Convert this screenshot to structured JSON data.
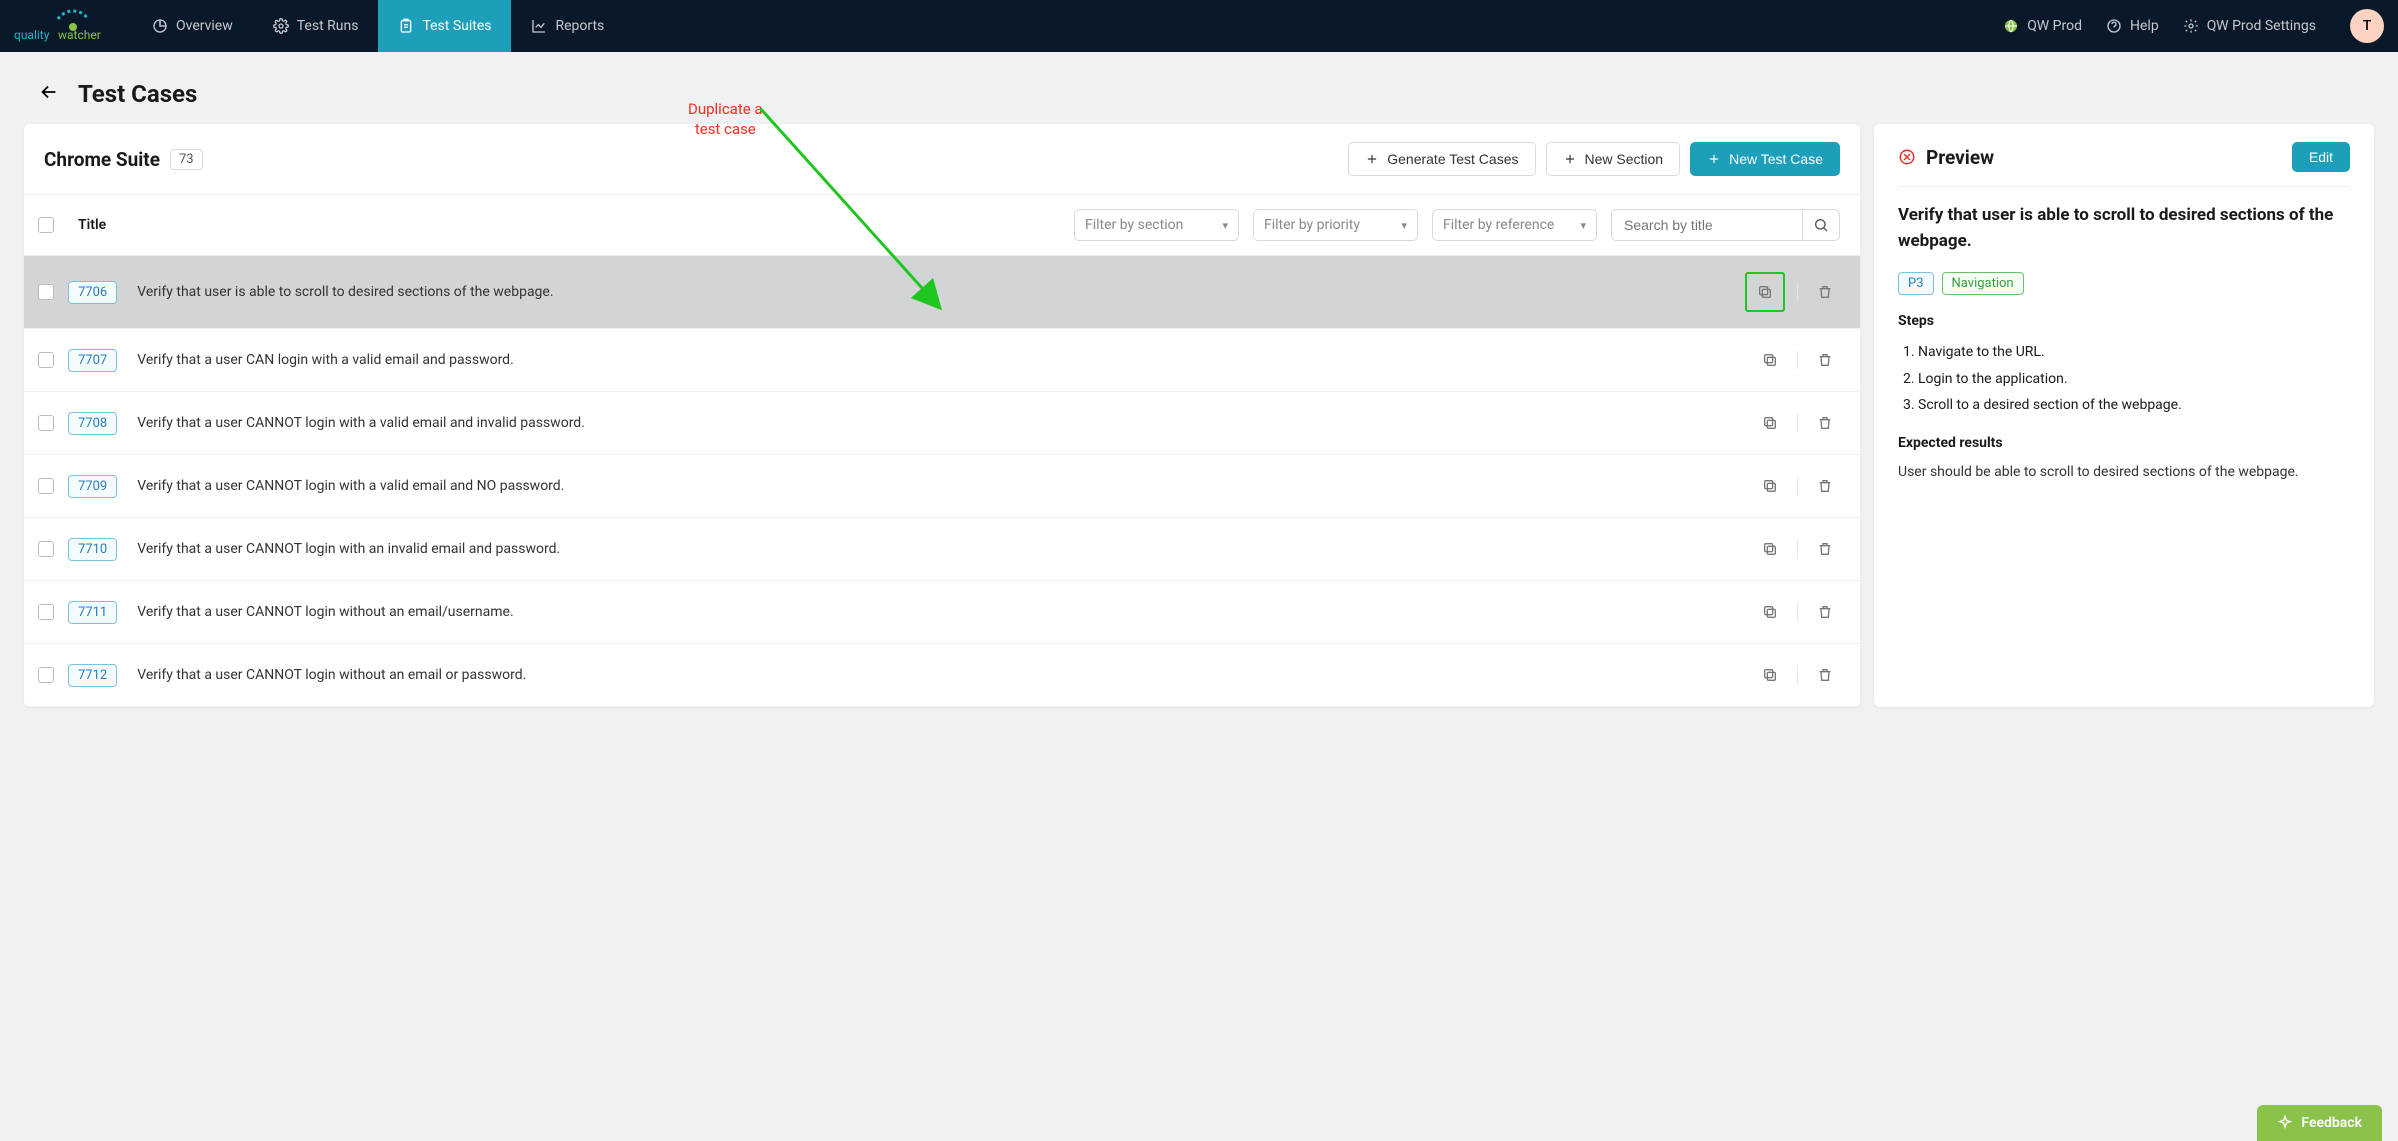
{
  "brand": {
    "name": "qualitywatcher",
    "accent": "#1d9fba"
  },
  "nav": {
    "overview": "Overview",
    "test_runs": "Test Runs",
    "test_suites": "Test Suites",
    "reports": "Reports",
    "workspace": "QW Prod",
    "help": "Help",
    "settings": "QW Prod Settings",
    "avatar": "T"
  },
  "page": {
    "title": "Test Cases"
  },
  "suite": {
    "title": "Chrome Suite",
    "count": "73",
    "actions": {
      "generate": "Generate Test Cases",
      "new_section": "New Section",
      "new_test": "New Test Case"
    }
  },
  "filters": {
    "title_col": "Title",
    "section": "Filter by section",
    "priority": "Filter by priority",
    "reference": "Filter by reference",
    "search_placeholder": "Search by title"
  },
  "rows": [
    {
      "id": "7706",
      "title": "Verify that user is able to scroll to desired sections of the webpage.",
      "selected": true,
      "highlight": true
    },
    {
      "id": "7707",
      "title": "Verify that a user CAN login with a valid email and password."
    },
    {
      "id": "7708",
      "title": "Verify that a user CANNOT login with a valid email and invalid password."
    },
    {
      "id": "7709",
      "title": "Verify that a user CANNOT login with a valid email and NO password."
    },
    {
      "id": "7710",
      "title": "Verify that a user CANNOT login with an invalid email and password."
    },
    {
      "id": "7711",
      "title": "Verify that a user CANNOT login without an email/username."
    },
    {
      "id": "7712",
      "title": "Verify that a user CANNOT login without an email or password."
    }
  ],
  "preview": {
    "heading": "Preview",
    "edit": "Edit",
    "title": "Verify that user is able to scroll to desired sections of the webpage.",
    "priority": "P3",
    "tag": "Navigation",
    "steps_h": "Steps",
    "steps": [
      "Navigate to the URL.",
      "Login to the application.",
      "Scroll to a desired section of the webpage."
    ],
    "expected_h": "Expected results",
    "expected": "User should be able to scroll to desired sections of the webpage."
  },
  "annotation": {
    "line1": "Duplicate a",
    "line2": "test case"
  },
  "feedback": "Feedback"
}
